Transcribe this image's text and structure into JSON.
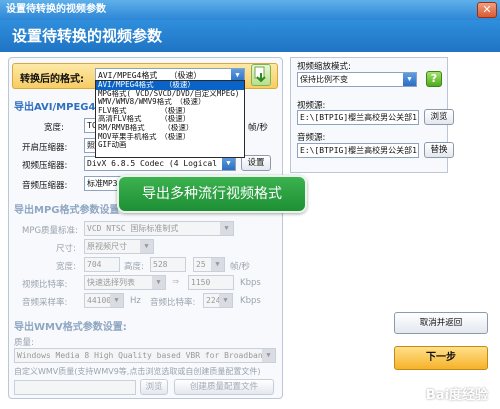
{
  "window": {
    "title": "设置待转换的视频参数"
  },
  "header": {
    "title": "设置待转换的视频参数"
  },
  "format": {
    "label": "转换后的格式:",
    "selected": "AVI/MPEG4格式　　（极速）",
    "options": [
      "AVI/MPEG4格式　　（极速）",
      "MPG格式( VCD/SVCD/DVD/自定义MPEG)",
      "WMV/WMV8/WMV9格式　（极速）",
      "FLV格式　　　　　（极速）",
      "高清FLV格式　　　（极速）",
      "RM/RMVB格式　　　（极速）",
      "MOV苹果手机格式　（极速）",
      "GIF动画"
    ]
  },
  "avi": {
    "title": "导出AVI/MPEG4格",
    "width_label": "宽度:",
    "width_value": "TC",
    "fps_suffix": "帧/秒",
    "open_compressor_label": "开启压缩器:",
    "open_compressor_value": "照",
    "video_compressor_label": "视频压缩器:",
    "video_compressor_value": "DivX 6.8.5 Codec (4 Logical CPU",
    "settings_button": "设置",
    "audio_compressor_label": "音频压缩器:",
    "audio_compressor_value": "标准MP3音"
  },
  "mpg": {
    "title": "导出MPG格式参数设置",
    "quality_label": "MPG质量标准:",
    "quality_value": "VCD  NTSC 国际标准制式",
    "size_label": "尺寸:",
    "size_value": "原视频尺寸",
    "width_label": "宽度:",
    "width_value": "704",
    "height_label": "高度:",
    "height_value": "528",
    "fps_value": "25",
    "fps_unit": "帧/秒",
    "video_bitrate_label": "视频比特率:",
    "video_bitrate_value": "快速选择列表",
    "video_bitrate_num": "1150",
    "video_bitrate_unit": "Kbps",
    "audio_freq_label": "音频采样率:",
    "audio_freq_value": "44100",
    "audio_freq_unit": "Hz",
    "audio_bitrate_label": "音频比特率:",
    "audio_bitrate_value": "224",
    "audio_bitrate_unit": "Kbps"
  },
  "wmv": {
    "title": "导出WMV格式参数设置:",
    "quality_label": "质量:",
    "quality_value": "Windows Media 8 High Quality based VBR for Broadband",
    "custom_label": "自定义WMV质量(支持WMV9等,点击浏览选取或自创建质量配置文件)",
    "browse_button": "浏览",
    "create_button": "创建质量配置文件"
  },
  "video_scale": {
    "label": "视频缩放模式:",
    "value": "保持比例不变",
    "help_icon": "?"
  },
  "video_source": {
    "label": "视频源:",
    "value": "E:\\[BTPIG]樱兰高校男公关部1-26全(",
    "browse_button": "浏览"
  },
  "audio_source": {
    "label": "音频源:",
    "value": "E:\\[BTPIG]樱兰高校男公关部1-26全(",
    "replace_button": "替换"
  },
  "buttons": {
    "cancel": "取消并返回",
    "next": "下一步"
  },
  "tooltip": "导出多种流行视频格式",
  "watermark": "Bai度经验"
}
